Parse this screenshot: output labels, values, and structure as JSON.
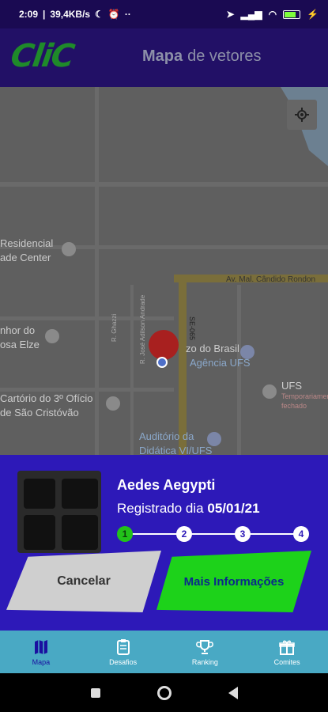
{
  "status_bar": {
    "time": "2:09",
    "speed": "39,4KB/s",
    "battery": "85"
  },
  "header": {
    "logo": "CliC",
    "title_bold": "Mapa",
    "title_rest": "de vetores"
  },
  "map": {
    "labels": {
      "residencial_1": "Residencial",
      "residencial_2": "ade Center",
      "anhor_1": "nhor do",
      "anhor_2": "osa Elze",
      "cartorio_1": "Cartório do 3º Ofício",
      "cartorio_2": "de São Cristóvão",
      "av_rondon": "Av. Mal. Cândido Rondon",
      "banco_1": "zo do Brasil",
      "banco_2": "Agência UFS",
      "ufs": "UFS",
      "ufs_sub_1": "Temporariamente",
      "ufs_sub_2": "fechado",
      "auditorio_1": "Auditório da",
      "auditorio_2": "Didática VI/UFS",
      "se": "SE-065",
      "r_jose": "R. José Adilson Andrade",
      "r_sub": "R. Ghazzi"
    }
  },
  "panel": {
    "species": "Aedes Aegypti",
    "reg_label": "Registrado dia",
    "reg_date": "05/01/21",
    "steps": [
      "1",
      "2",
      "3",
      "4"
    ],
    "cancel_label": "Cancelar",
    "more_label": "Mais Informações"
  },
  "nav": {
    "items": [
      {
        "label": "Mapa",
        "icon": "map-icon"
      },
      {
        "label": "Desafios",
        "icon": "clipboard-icon"
      },
      {
        "label": "Ranking",
        "icon": "trophy-icon"
      },
      {
        "label": "Comites",
        "icon": "gift-icon"
      }
    ]
  },
  "colors": {
    "header": "#221066",
    "panel": "#2d19b8",
    "accent_green": "#1dd21a",
    "nav": "#49a9c4"
  }
}
